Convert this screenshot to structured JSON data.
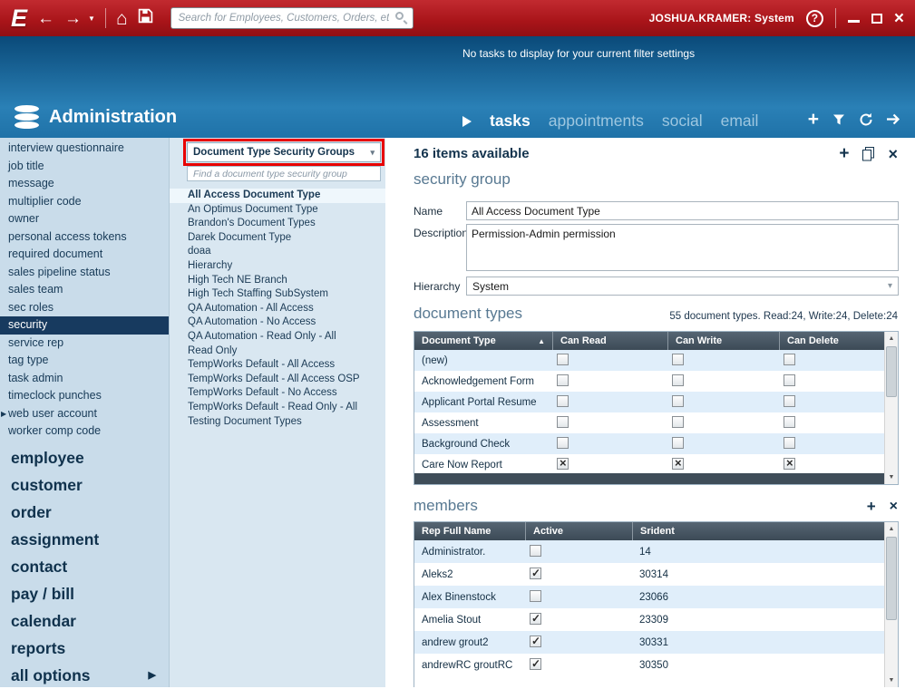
{
  "titlebar": {
    "logo": "E",
    "search_placeholder": "Search for Employees, Customers, Orders, etc.",
    "user_label": "JOSHUA.KRAMER: System"
  },
  "header": {
    "title": "Administration",
    "no_tasks_message": "No tasks to display for your current filter settings",
    "tabs": [
      {
        "label": "tasks",
        "active": true
      },
      {
        "label": "appointments",
        "active": false
      },
      {
        "label": "social",
        "active": false
      },
      {
        "label": "email",
        "active": false
      }
    ]
  },
  "sidebar": {
    "small_items": [
      {
        "label": "interview questionnaire"
      },
      {
        "label": "job title"
      },
      {
        "label": "message"
      },
      {
        "label": "multiplier code"
      },
      {
        "label": "owner"
      },
      {
        "label": "personal access tokens"
      },
      {
        "label": "required document"
      },
      {
        "label": "sales pipeline status"
      },
      {
        "label": "sales team"
      },
      {
        "label": "sec roles"
      },
      {
        "label": "security",
        "selected": true
      },
      {
        "label": "service rep"
      },
      {
        "label": "tag type"
      },
      {
        "label": "task admin"
      },
      {
        "label": "timeclock punches"
      },
      {
        "label": "web user account",
        "expandable": true
      },
      {
        "label": "worker comp code"
      }
    ],
    "big_items": [
      {
        "label": "employee"
      },
      {
        "label": "customer"
      },
      {
        "label": "order"
      },
      {
        "label": "assignment"
      },
      {
        "label": "contact"
      },
      {
        "label": "pay / bill"
      },
      {
        "label": "calendar"
      },
      {
        "label": "reports"
      },
      {
        "label": "all options",
        "arrow": true
      }
    ]
  },
  "picker": {
    "dropdown_value": "Document Type Security Groups",
    "search_placeholder": "Find a document type security group",
    "items": [
      {
        "label": "All Access Document Type",
        "selected": true
      },
      {
        "label": "An Optimus Document Type"
      },
      {
        "label": "Brandon's Document Types"
      },
      {
        "label": "Darek Document Type"
      },
      {
        "label": "doaa"
      },
      {
        "label": "Hierarchy"
      },
      {
        "label": "High Tech NE Branch"
      },
      {
        "label": "High Tech Staffing SubSystem"
      },
      {
        "label": "QA Automation - All Access"
      },
      {
        "label": "QA Automation - No Access"
      },
      {
        "label": "QA Automation - Read Only - All"
      },
      {
        "label": "Read Only"
      },
      {
        "label": "TempWorks Default - All Access"
      },
      {
        "label": "TempWorks Default - All Access OSP"
      },
      {
        "label": "TempWorks Default - No Access"
      },
      {
        "label": "TempWorks Default - Read Only - All"
      },
      {
        "label": "Testing Document Types"
      }
    ]
  },
  "main": {
    "items_available": "16 items available",
    "security_group": {
      "heading": "security group",
      "name_label": "Name",
      "name_value": "All Access Document Type",
      "description_label": "Description",
      "description_value": "Permission-Admin permission",
      "hierarchy_label": "Hierarchy",
      "hierarchy_value": "System"
    },
    "document_types": {
      "heading": "document types",
      "summary": "55 document types. Read:24, Write:24, Delete:24",
      "columns": [
        "Document Type",
        "Can Read",
        "Can Write",
        "Can Delete"
      ],
      "rows": [
        {
          "name": "(new)",
          "read": false,
          "write": false,
          "delete": false
        },
        {
          "name": "Acknowledgement Form",
          "read": false,
          "write": false,
          "delete": false
        },
        {
          "name": "Applicant Portal Resume",
          "read": false,
          "write": false,
          "delete": false
        },
        {
          "name": "Assessment",
          "read": false,
          "write": false,
          "delete": false
        },
        {
          "name": "Background Check",
          "read": false,
          "write": false,
          "delete": false
        },
        {
          "name": "Care Now Report",
          "read": true,
          "write": true,
          "delete": true
        }
      ]
    },
    "members": {
      "heading": "members",
      "columns": [
        "Rep Full Name",
        "Active",
        "Srident"
      ],
      "rows": [
        {
          "name": "Administrator.",
          "active": false,
          "srident": "14"
        },
        {
          "name": "Aleks2",
          "active": true,
          "srident": "30314"
        },
        {
          "name": "Alex Binenstock",
          "active": false,
          "srident": "23066"
        },
        {
          "name": "Amelia Stout",
          "active": true,
          "srident": "23309"
        },
        {
          "name": "andrew grout2",
          "active": true,
          "srident": "30331"
        },
        {
          "name": "andrewRC groutRC",
          "active": true,
          "srident": "30350"
        }
      ]
    }
  }
}
